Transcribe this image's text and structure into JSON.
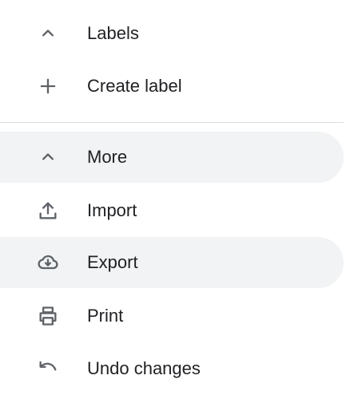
{
  "menu": {
    "labels_section": {
      "label": "Labels",
      "icon": "chevron-up-icon"
    },
    "create_label": {
      "label": "Create label",
      "icon": "plus-icon"
    },
    "more_section": {
      "label": "More",
      "icon": "chevron-up-icon"
    },
    "items": [
      {
        "label": "Import",
        "icon": "upload-icon"
      },
      {
        "label": "Export",
        "icon": "cloud-download-icon"
      },
      {
        "label": "Print",
        "icon": "printer-icon"
      },
      {
        "label": "Undo changes",
        "icon": "undo-icon"
      }
    ]
  },
  "colors": {
    "text": "#202124",
    "icon": "#5f6368",
    "highlight": "#f1f3f4",
    "divider": "#dadce0"
  }
}
